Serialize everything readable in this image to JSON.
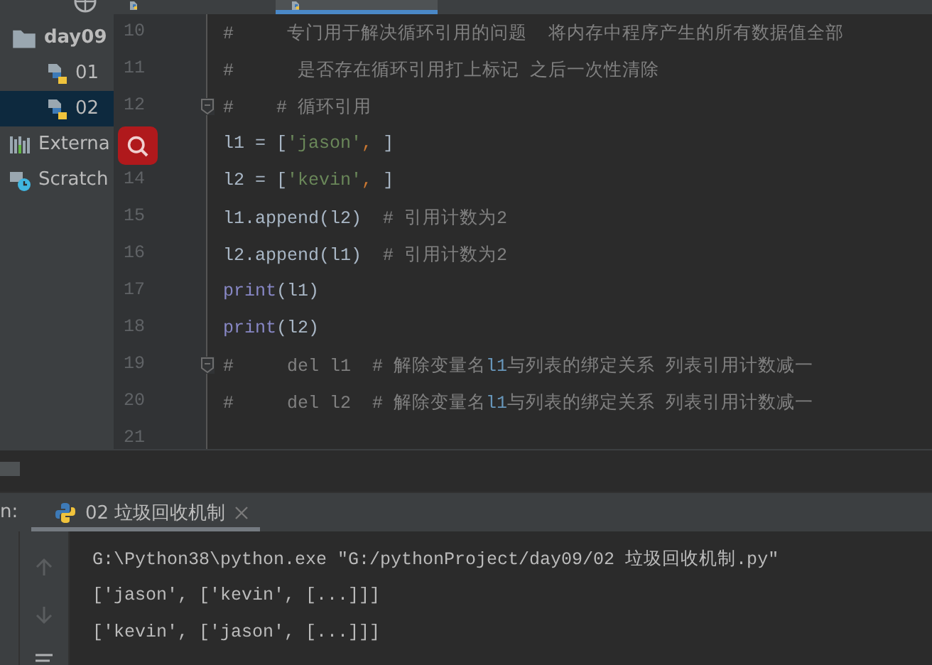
{
  "top_tabs": [
    {
      "selected": false
    },
    {
      "selected": true
    }
  ],
  "project_tree": [
    {
      "label": "day09",
      "kind": "folder",
      "selected": false
    },
    {
      "label": "01",
      "kind": "python",
      "selected": false
    },
    {
      "label": "02",
      "kind": "python",
      "selected": true
    },
    {
      "label": "Externa",
      "kind": "library",
      "selected": false
    },
    {
      "label": "Scratch",
      "kind": "scratch",
      "selected": false
    }
  ],
  "editor": {
    "lines": [
      {
        "number": "10",
        "fold": false,
        "tokens": [
          {
            "kind": "comment",
            "text": "#     专门用于解决循环引用的问题  将内存中程序产生的所有数据值全部"
          }
        ]
      },
      {
        "number": "11",
        "fold": false,
        "tokens": [
          {
            "kind": "comment",
            "text": "#      是否存在循环引用打上标记 之后一次性清除"
          }
        ]
      },
      {
        "number": "12",
        "fold": true,
        "tokens": [
          {
            "kind": "comment",
            "text": "#    # 循环引用"
          }
        ]
      },
      {
        "fold": false,
        "tokens": [
          {
            "kind": "plain",
            "text": "l1 = "
          },
          {
            "kind": "bracket",
            "text": "["
          },
          {
            "kind": "string",
            "text": "'jason'"
          },
          {
            "kind": "punct",
            "text": ", "
          },
          {
            "kind": "bracket",
            "text": "]"
          }
        ]
      },
      {
        "number": "14",
        "fold": false,
        "tokens": [
          {
            "kind": "plain",
            "text": "l2 = "
          },
          {
            "kind": "bracket",
            "text": "["
          },
          {
            "kind": "string",
            "text": "'kevin'"
          },
          {
            "kind": "punct",
            "text": ", "
          },
          {
            "kind": "bracket",
            "text": "]"
          }
        ]
      },
      {
        "number": "15",
        "fold": false,
        "tokens": [
          {
            "kind": "plain",
            "text": "l1.append(l2)  "
          },
          {
            "kind": "comment",
            "text": "# 引用计数为2"
          }
        ]
      },
      {
        "number": "16",
        "fold": false,
        "tokens": [
          {
            "kind": "plain",
            "text": "l2.append(l1)  "
          },
          {
            "kind": "comment",
            "text": "# 引用计数为2"
          }
        ]
      },
      {
        "number": "17",
        "fold": false,
        "tokens": [
          {
            "kind": "builtin",
            "text": "print"
          },
          {
            "kind": "plain",
            "text": "(l1)"
          }
        ]
      },
      {
        "number": "18",
        "fold": false,
        "tokens": [
          {
            "kind": "builtin",
            "text": "print"
          },
          {
            "kind": "plain",
            "text": "(l2)"
          }
        ]
      },
      {
        "number": "19",
        "fold": true,
        "tokens": [
          {
            "kind": "comment",
            "text": "#     del l1  # 解除变量名"
          },
          {
            "kind": "comment_ref",
            "text": "l1"
          },
          {
            "kind": "comment",
            "text": "与列表的绑定关系 列表引用计数减一"
          }
        ]
      },
      {
        "number": "20",
        "fold": false,
        "tokens": [
          {
            "kind": "comment",
            "text": "#     del l2  # 解除变量名"
          },
          {
            "kind": "comment_ref",
            "text": "l1"
          },
          {
            "kind": "comment",
            "text": "与列表的绑定关系 列表引用计数减一"
          }
        ]
      },
      {
        "number": "21",
        "fold": false
      }
    ]
  },
  "run_panel": {
    "label": "n:",
    "tabs": [
      {
        "label": "02 垃圾回收机制",
        "selected": true
      }
    ],
    "console_lines": [
      "G:\\Python38\\python.exe \"G:/pythonProject/day09/02 垃圾回收机制.py\"",
      "['jason', ['kevin', [...]]]",
      "['kevin', ['jason', [...]]]"
    ]
  }
}
